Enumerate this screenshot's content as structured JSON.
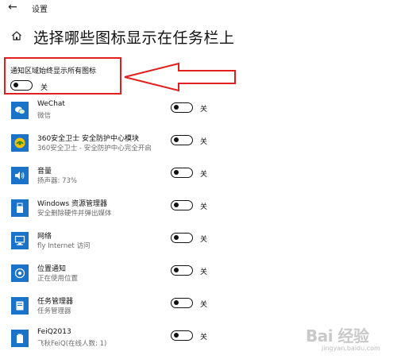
{
  "window": {
    "title": "设置"
  },
  "page": {
    "title": "选择哪些图标显示在任务栏上"
  },
  "master": {
    "label": "通知区域始终显示所有图标",
    "state": "关"
  },
  "apps": [
    {
      "name": "WeChat",
      "sub": "微信",
      "state": "关",
      "icon": "wechat-icon"
    },
    {
      "name": "360安全卫士 安全防护中心模块",
      "sub": "360安全卫士 - 安全防护中心完全开启",
      "state": "关",
      "icon": "shield-360-icon"
    },
    {
      "name": "音量",
      "sub": "扬声器: 73%",
      "state": "关",
      "icon": "speaker-icon"
    },
    {
      "name": "Windows 资源管理器",
      "sub": "安全删除硬件并弹出媒体",
      "state": "关",
      "icon": "usb-icon"
    },
    {
      "name": "网络",
      "sub": "fly Internet 访问",
      "state": "关",
      "icon": "network-icon"
    },
    {
      "name": "位置通知",
      "sub": "正在使用位置",
      "state": "关",
      "icon": "location-icon"
    },
    {
      "name": "任务管理器",
      "sub": "任务管理器",
      "state": "关",
      "icon": "task-manager-icon"
    },
    {
      "name": "FeiQ2013",
      "sub": "飞秋FeiQ(在线人数: 1)",
      "state": "关",
      "icon": "feiq-icon"
    }
  ],
  "watermark": {
    "main": "Bai 经验",
    "sub": "jingyan.baidu.com"
  },
  "colors": {
    "tile": "#1a73c8",
    "highlight": "#e02020"
  }
}
